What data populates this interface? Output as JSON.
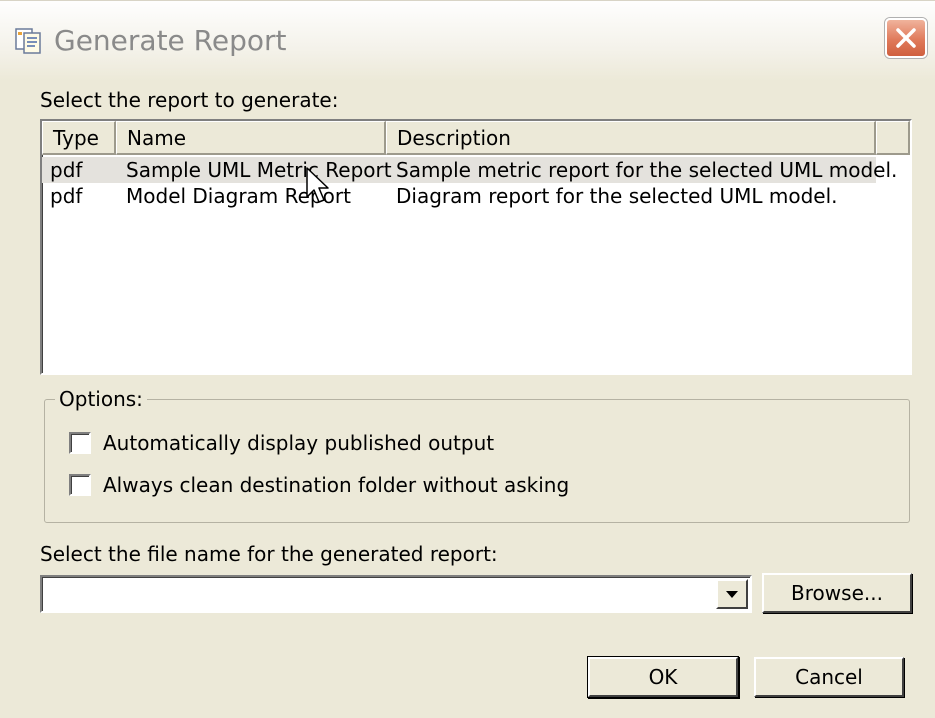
{
  "window": {
    "title": "Generate Report",
    "title_icon": "report-document-icon",
    "close_icon": "close-icon"
  },
  "report_section": {
    "label": "Select the report to generate:",
    "columns": [
      "Type",
      "Name",
      "Description"
    ],
    "rows": [
      {
        "type": "pdf",
        "name": "Sample UML Metric Report",
        "description": "Sample metric report for the selected UML model.",
        "selected": true
      },
      {
        "type": "pdf",
        "name": "Model Diagram Report",
        "description": "Diagram report for the selected UML model.",
        "selected": false
      }
    ]
  },
  "options": {
    "legend": "Options:",
    "auto_display": {
      "label": "Automatically display published output",
      "checked": false
    },
    "always_clean": {
      "label": "Always clean destination folder without asking",
      "checked": false
    }
  },
  "file_section": {
    "label": "Select the file name for the generated report:",
    "value": "",
    "browse_label": "Browse..."
  },
  "buttons": {
    "ok_label": "OK",
    "cancel_label": "Cancel"
  },
  "colors": {
    "dialog_bg": "#ece9d8",
    "close_button": "#e07a5b",
    "selected_row": "#e4e2dd"
  }
}
